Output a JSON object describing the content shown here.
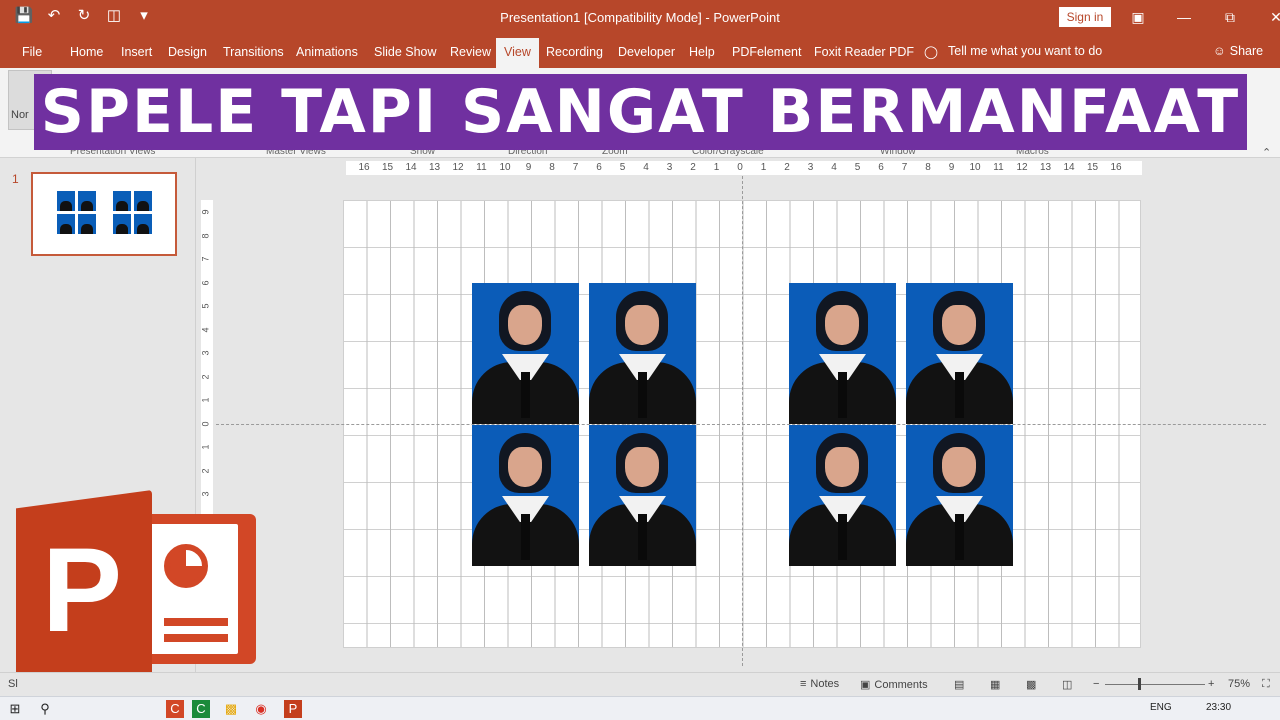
{
  "window": {
    "title": "Presentation1 [Compatibility Mode]  -  PowerPoint",
    "sign_in": "Sign in"
  },
  "quick_access": [
    "save-icon",
    "undo-icon",
    "redo-icon",
    "present-icon",
    "customize-icon"
  ],
  "tabs": [
    "File",
    "Home",
    "Insert",
    "Design",
    "Transitions",
    "Animations",
    "Slide Show",
    "Review",
    "View",
    "Recording",
    "Developer",
    "Help",
    "PDFelement",
    "Foxit Reader PDF"
  ],
  "active_tab": "View",
  "tell_me": "Tell me what you want to do",
  "share": "Share",
  "ribbon": {
    "normal_label": "Nor",
    "groups": [
      "Presentation Views",
      "Master Views",
      "Show",
      "Direction",
      "Zoom",
      "Color/Grayscale",
      "Window",
      "Macros"
    ]
  },
  "banner": "SPELE TAPI SANGAT BERMANFAAT",
  "slide_panel": {
    "slide_number": "1"
  },
  "ruler": {
    "horizontal": [
      "16",
      "15",
      "14",
      "13",
      "12",
      "11",
      "10",
      "9",
      "8",
      "7",
      "6",
      "5",
      "4",
      "3",
      "2",
      "1",
      "0",
      "1",
      "2",
      "3",
      "4",
      "5",
      "6",
      "7",
      "8",
      "9",
      "10",
      "11",
      "12",
      "13",
      "14",
      "15",
      "16"
    ],
    "vertical": [
      "9",
      "8",
      "7",
      "6",
      "5",
      "4",
      "3",
      "2",
      "1",
      "0",
      "1",
      "2",
      "3"
    ]
  },
  "photos_count": 8,
  "status": {
    "slide": "Sl",
    "notes": "Notes",
    "comments": "Comments",
    "zoom": "75%",
    "zoom_minus": "−",
    "zoom_plus": "+"
  },
  "taskbar": {
    "language": "ENG",
    "time": "23:30"
  },
  "colors": {
    "ppt_accent": "#b7472a",
    "banner_bg": "#7030a0",
    "photo_bg": "#0b5cb8"
  }
}
